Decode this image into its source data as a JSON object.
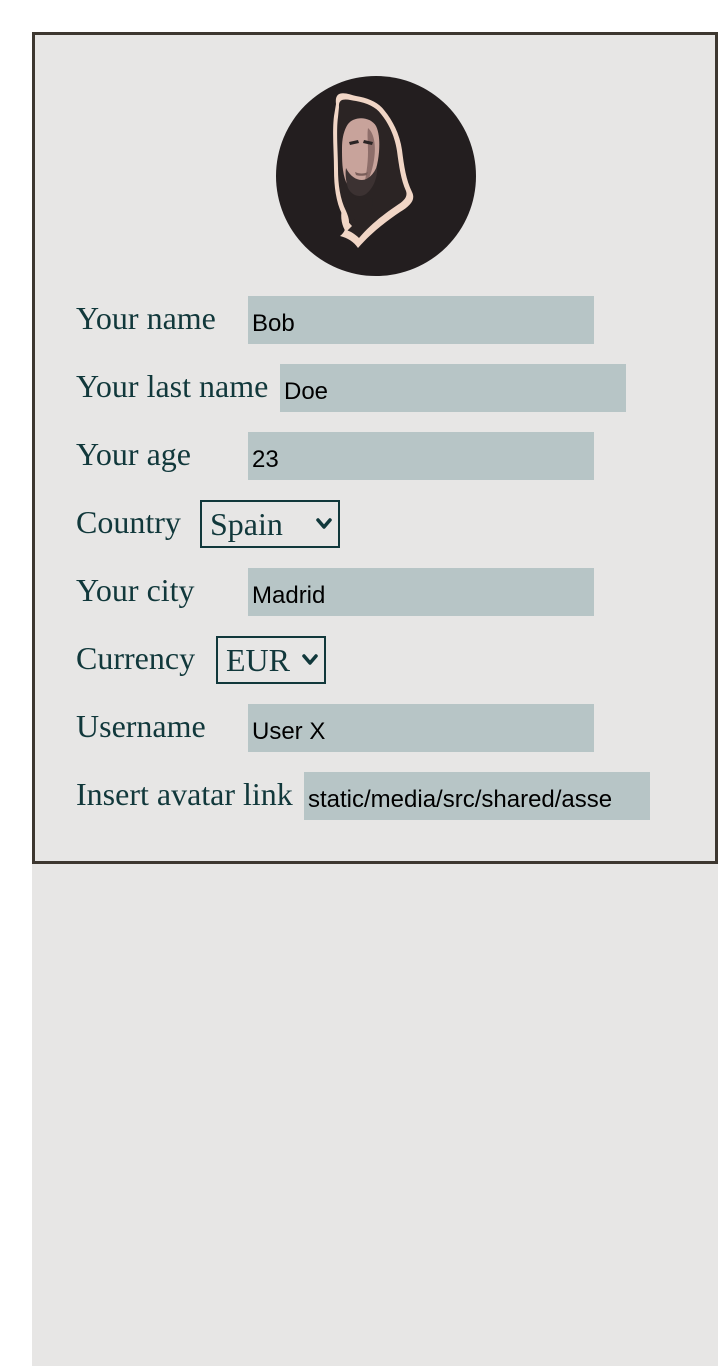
{
  "profile": {
    "avatar_icon": "portrait-avatar",
    "name": {
      "label": "Your name",
      "value": "Bob"
    },
    "last_name": {
      "label": "Your last name",
      "value": "Doe"
    },
    "age": {
      "label": "Your age",
      "value": "23"
    },
    "country": {
      "label": "Country",
      "value": "Spain"
    },
    "city": {
      "label": "Your city",
      "value": "Madrid"
    },
    "currency": {
      "label": "Currency",
      "value": "EUR"
    },
    "username": {
      "label": "Username",
      "value": "User X"
    },
    "avatar_link": {
      "label": "Insert avatar link",
      "value": "static/media/src/shared/asse"
    }
  },
  "colors": {
    "card_bg": "#e7e6e5",
    "card_border": "#3d3730",
    "label_text": "#11383b",
    "input_bg": "#b7c5c6",
    "avatar_bg": "#231e1f"
  },
  "icons": {
    "select_arrow": "chevron-down-icon"
  }
}
